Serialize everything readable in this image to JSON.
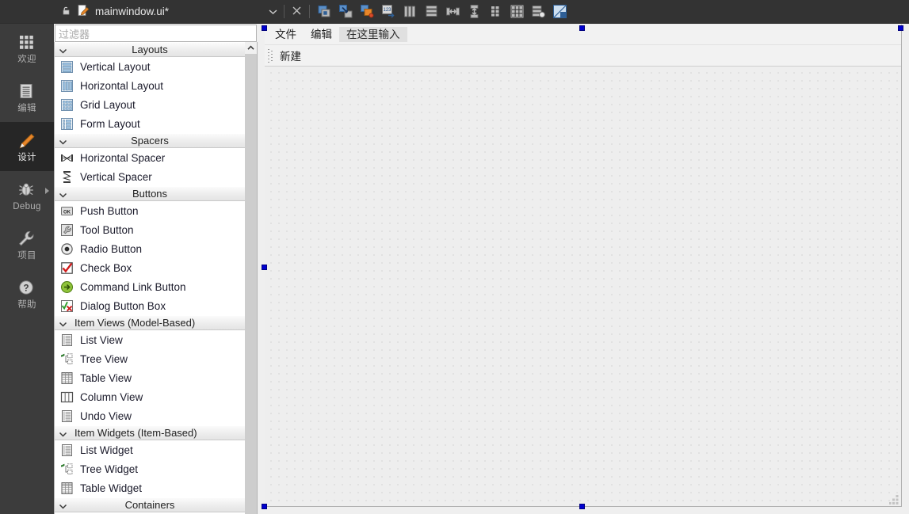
{
  "modebar": {
    "items": [
      {
        "label": "欢迎",
        "icon": "grid-apps-icon",
        "active": false,
        "has_arrow": false
      },
      {
        "label": "编辑",
        "icon": "document-lines-icon",
        "active": false,
        "has_arrow": false
      },
      {
        "label": "设计",
        "icon": "pencil-icon",
        "active": true,
        "has_arrow": false
      },
      {
        "label": "Debug",
        "icon": "bug-icon",
        "active": false,
        "has_arrow": true
      },
      {
        "label": "项目",
        "icon": "wrench-icon",
        "active": false,
        "has_arrow": false
      },
      {
        "label": "帮助",
        "icon": "question-circle-icon",
        "active": false,
        "has_arrow": false
      }
    ]
  },
  "filetab": {
    "title": "mainwindow.ui*",
    "lock_icon": "unlocked-icon",
    "file_icon": "edit-document-icon",
    "dropdown_icon": "chevron-down-icon",
    "close_icon": "close-x-icon"
  },
  "toolbar": {
    "buttons": [
      {
        "name": "adjust-size-button",
        "icon": "adjust-size-icon"
      },
      {
        "name": "break-layout-button",
        "icon": "break-layout-icon"
      },
      {
        "name": "edit-signals-slots-button",
        "icon": "signals-slots-icon"
      },
      {
        "name": "edit-tab-order-button",
        "icon": "tab-order-icon"
      },
      {
        "name": "layout-horizontal-button",
        "icon": "layout-horizontal-icon"
      },
      {
        "name": "layout-vertical-button",
        "icon": "layout-vertical-icon"
      },
      {
        "name": "layout-splitter-horizontal-button",
        "icon": "splitter-horizontal-icon"
      },
      {
        "name": "layout-splitter-vertical-button",
        "icon": "splitter-vertical-icon"
      },
      {
        "name": "layout-form-button",
        "icon": "layout-form-icon"
      },
      {
        "name": "layout-grid-button",
        "icon": "layout-grid-icon"
      },
      {
        "name": "layout-stacked-button",
        "icon": "layout-stacked-icon"
      },
      {
        "name": "preview-button",
        "icon": "preview-icon"
      }
    ]
  },
  "widgetbox": {
    "filter_placeholder": "过滤器",
    "filter_value": "",
    "scroll_up_icon": "chevron-up-icon",
    "sections": [
      {
        "title": "Layouts",
        "expanded": true,
        "align": "center",
        "items": [
          {
            "label": "Vertical Layout",
            "icon": "vertical-layout-icon"
          },
          {
            "label": "Horizontal Layout",
            "icon": "horizontal-layout-icon"
          },
          {
            "label": "Grid Layout",
            "icon": "grid-layout-icon"
          },
          {
            "label": "Form Layout",
            "icon": "form-layout-icon"
          }
        ]
      },
      {
        "title": "Spacers",
        "expanded": true,
        "align": "center",
        "items": [
          {
            "label": "Horizontal Spacer",
            "icon": "horizontal-spacer-icon"
          },
          {
            "label": "Vertical Spacer",
            "icon": "vertical-spacer-icon"
          }
        ]
      },
      {
        "title": "Buttons",
        "expanded": true,
        "align": "center",
        "items": [
          {
            "label": "Push Button",
            "icon": "push-button-icon"
          },
          {
            "label": "Tool Button",
            "icon": "tool-button-icon"
          },
          {
            "label": "Radio Button",
            "icon": "radio-button-icon"
          },
          {
            "label": "Check Box",
            "icon": "check-box-icon"
          },
          {
            "label": "Command Link Button",
            "icon": "command-link-icon"
          },
          {
            "label": "Dialog Button Box",
            "icon": "dialog-button-box-icon"
          }
        ]
      },
      {
        "title": "Item Views (Model-Based)",
        "expanded": true,
        "align": "left",
        "items": [
          {
            "label": "List View",
            "icon": "list-view-icon"
          },
          {
            "label": "Tree View",
            "icon": "tree-view-icon"
          },
          {
            "label": "Table View",
            "icon": "table-view-icon"
          },
          {
            "label": "Column View",
            "icon": "column-view-icon"
          },
          {
            "label": "Undo View",
            "icon": "undo-view-icon"
          }
        ]
      },
      {
        "title": "Item Widgets (Item-Based)",
        "expanded": true,
        "align": "left",
        "items": [
          {
            "label": "List Widget",
            "icon": "list-widget-icon"
          },
          {
            "label": "Tree Widget",
            "icon": "tree-widget-icon"
          },
          {
            "label": "Table Widget",
            "icon": "table-widget-icon"
          }
        ]
      },
      {
        "title": "Containers",
        "expanded": true,
        "align": "center",
        "items": []
      }
    ]
  },
  "formeditor": {
    "menubar": [
      {
        "label": "文件",
        "placeholder": false
      },
      {
        "label": "编辑",
        "placeholder": false
      },
      {
        "label": "在这里输入",
        "placeholder": true
      }
    ],
    "toolbar": [
      {
        "label": "新建"
      }
    ],
    "selection_handles": 4,
    "grip_icon": "toolbar-grip-icon",
    "sizegrip_icon": "size-grip-icon"
  },
  "colors": {
    "modebar_bg": "#3c3c3c",
    "modebar_active": "#262626",
    "tabstrip_bg": "#333333",
    "accent_handle": "#0000cf",
    "canvas_bg": "#eeeeee",
    "panel_bg": "#efefef"
  }
}
